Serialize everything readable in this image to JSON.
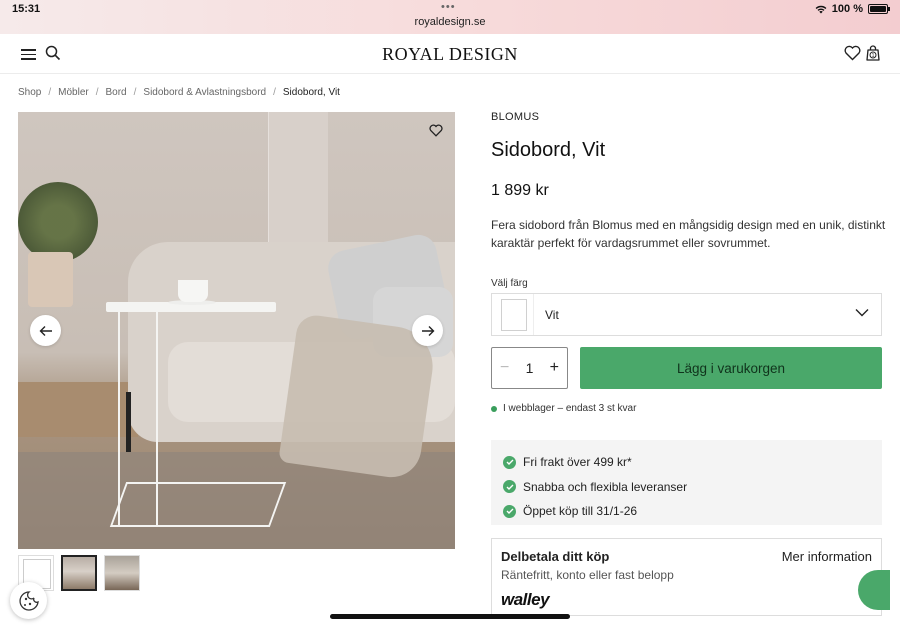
{
  "status_bar": {
    "time": "15:31",
    "url": "royaldesign.se",
    "battery": "100 %"
  },
  "header": {
    "logo": "ROYAL DESIGN"
  },
  "breadcrumb": [
    "Shop",
    "Möbler",
    "Bord",
    "Sidobord & Avlastningsbord",
    "Sidobord, Vit"
  ],
  "product": {
    "brand": "BLOMUS",
    "title": "Sidobord, Vit",
    "price": "1 899 kr",
    "description": "Fera sidobord från Blomus med en mångsidig design med en unik, distinkt karaktär perfekt för vardagsrummet eller sovrummet.",
    "color_label": "Välj färg",
    "color_value": "Vit",
    "quantity": "1",
    "add_to_cart": "Lägg i varukorgen",
    "stock": "I webblager – endast 3 st kvar"
  },
  "usps": [
    "Fri frakt över 499 kr*",
    "Snabba och flexibla leveranser",
    "Öppet köp till 31/1-26"
  ],
  "finance": {
    "heading": "Delbetala ditt köp",
    "more": "Mer information",
    "subtitle": "Räntefritt, konto eller fast belopp",
    "provider": "walley"
  },
  "colors": {
    "accent": "#4aa86a",
    "stock_dot": "#3a9e5c"
  },
  "icons": {
    "menu": "menu-icon",
    "search": "search-icon",
    "wishlist": "heart-icon",
    "cart": "bag-icon",
    "prev": "arrow-left-icon",
    "next": "arrow-right-icon",
    "dropdown": "chevron-down-icon",
    "cookie": "cookie-icon",
    "check": "check-icon"
  }
}
